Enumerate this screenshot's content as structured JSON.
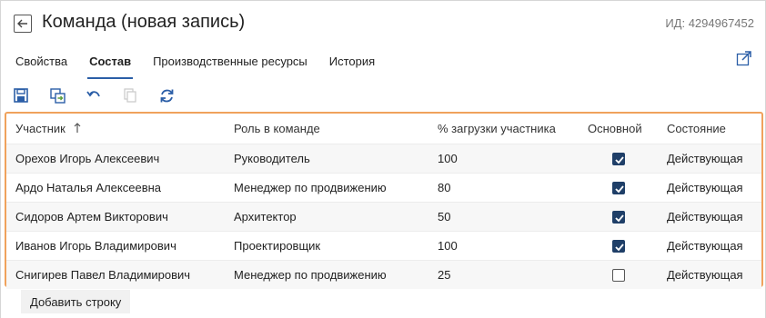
{
  "header": {
    "title": "Команда (новая запись)",
    "record_id": "ИД: 4294967452"
  },
  "tabs": [
    {
      "label": "Свойства",
      "active": false
    },
    {
      "label": "Состав",
      "active": true
    },
    {
      "label": "Производственные ресурсы",
      "active": false
    },
    {
      "label": "История",
      "active": false
    }
  ],
  "toolbar": {
    "icons": [
      "save-icon",
      "save-and-copy-icon",
      "undo-icon",
      "copy-icon",
      "refresh-icon"
    ]
  },
  "grid": {
    "columns": [
      "Участник",
      "Роль в команде",
      "% загрузки участника",
      "Основной",
      "Состояние"
    ],
    "sorted_column": "Участник",
    "sort_direction": "ascending",
    "rows": [
      {
        "member": "Орехов Игорь Алексеевич",
        "role": "Руководитель",
        "load": "100",
        "primary": true,
        "state": "Действующая"
      },
      {
        "member": "Ардо Наталья Алексеевна",
        "role": "Менеджер по продвижению",
        "load": "80",
        "primary": true,
        "state": "Действующая"
      },
      {
        "member": "Сидоров Артем Викторович",
        "role": "Архитектор",
        "load": "50",
        "primary": true,
        "state": "Действующая"
      },
      {
        "member": "Иванов Игорь Владимирович",
        "role": "Проектировщик",
        "load": "100",
        "primary": true,
        "state": "Действующая"
      },
      {
        "member": "Снигирев Павел Владимирович",
        "role": "Менеджер по продвижению",
        "load": "25",
        "primary": false,
        "state": "Действующая"
      }
    ]
  },
  "add_row_label": "Добавить строку",
  "colors": {
    "accent": "#2b5ea7",
    "selection_border": "#f0a25c",
    "checkbox_checked": "#1f3f68"
  }
}
